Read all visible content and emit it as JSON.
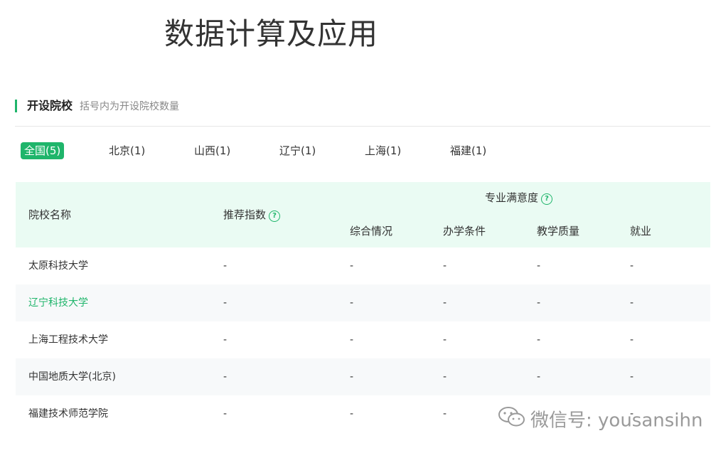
{
  "page": {
    "title": "数据计算及应用"
  },
  "section": {
    "title": "开设院校",
    "subtitle": "括号内为开设院校数量"
  },
  "tabs": [
    {
      "label": "全国(5)",
      "active": true
    },
    {
      "label": "北京(1)",
      "active": false
    },
    {
      "label": "山西(1)",
      "active": false
    },
    {
      "label": "辽宁(1)",
      "active": false
    },
    {
      "label": "上海(1)",
      "active": false
    },
    {
      "label": "福建(1)",
      "active": false
    }
  ],
  "table": {
    "headers": {
      "school": "院校名称",
      "recommend": "推荐指数",
      "satisfaction": "专业满意度",
      "overall": "综合情况",
      "conditions": "办学条件",
      "quality": "教学质量",
      "employment": "就业"
    },
    "rows": [
      {
        "school": "太原科技大学",
        "recommend": "-",
        "overall": "-",
        "conditions": "-",
        "quality": "-",
        "employment": "-"
      },
      {
        "school": "辽宁科技大学",
        "recommend": "-",
        "overall": "-",
        "conditions": "-",
        "quality": "-",
        "employment": "-"
      },
      {
        "school": "上海工程技术大学",
        "recommend": "-",
        "overall": "-",
        "conditions": "-",
        "quality": "-",
        "employment": "-"
      },
      {
        "school": "中国地质大学(北京)",
        "recommend": "-",
        "overall": "-",
        "conditions": "-",
        "quality": "-",
        "employment": "-"
      },
      {
        "school": "福建技术师范学院",
        "recommend": "-",
        "overall": "-",
        "conditions": "-",
        "quality": "-",
        "employment": "-"
      }
    ]
  },
  "watermark": {
    "text": "微信号: yousansihn"
  },
  "colors": {
    "accent": "#1fb56b",
    "header_bg": "#eafbf3",
    "alt_row": "#f7f9fa"
  },
  "icons": {
    "help": "help-circle-icon",
    "wechat": "wechat-icon"
  }
}
